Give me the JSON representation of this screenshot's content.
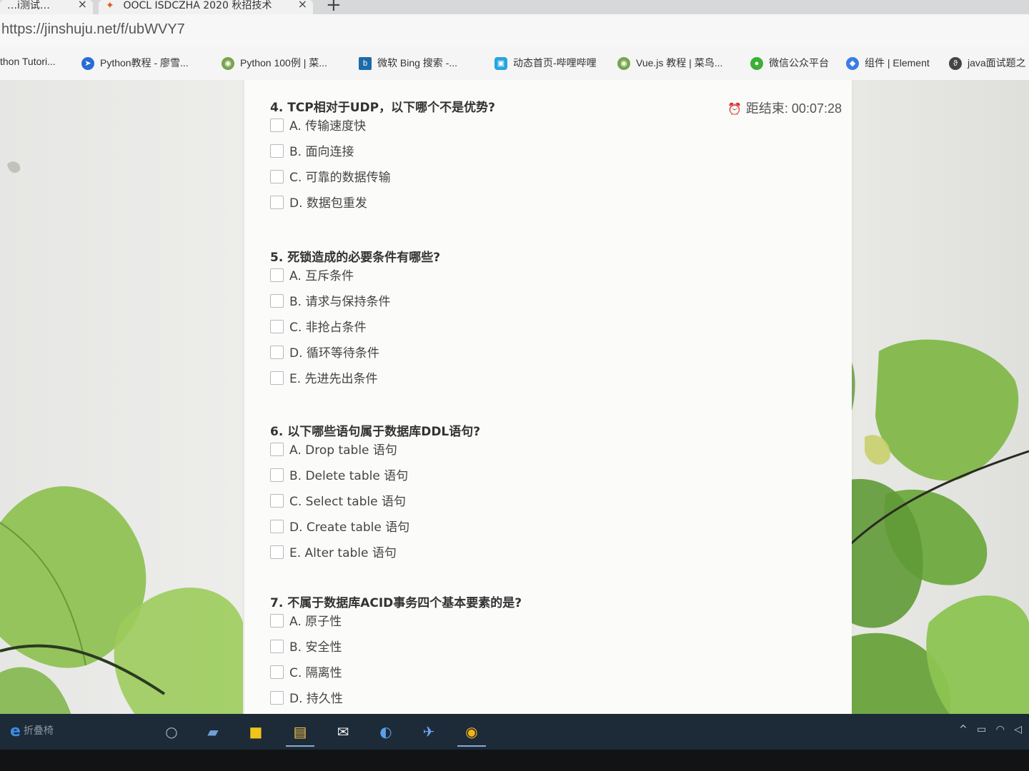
{
  "browser": {
    "tabs": [
      {
        "title": "…i测试…",
        "close": "×"
      },
      {
        "title": "OOCL ISDCZHA 2020 秋招技术",
        "close": "×"
      }
    ],
    "new_tab": "+",
    "url": "https://jinshuju.net/f/ubWVY7",
    "bookmarks": [
      {
        "label": "thon Tutori...",
        "icon": "bookmark-icon"
      },
      {
        "label": "Python教程 - 廖雪...",
        "icon": "rocket-icon"
      },
      {
        "label": "Python 100例 | 菜...",
        "icon": "runoob-icon"
      },
      {
        "label": "微软 Bing 搜索 -...",
        "icon": "bing-icon"
      },
      {
        "label": "动态首页-哔哩哔哩",
        "icon": "bilibili-icon"
      },
      {
        "label": "Vue.js 教程 | 菜鸟...",
        "icon": "runoob-icon"
      },
      {
        "label": "微信公众平台",
        "icon": "wechat-icon"
      },
      {
        "label": "组件 | Element",
        "icon": "element-icon"
      },
      {
        "label": "java面试题之",
        "icon": "java-icon"
      }
    ]
  },
  "form": {
    "timer_label": "距结束: 00:07:28",
    "questions": [
      {
        "title": "4. TCP相对于UDP，以下哪个不是优势?",
        "options": [
          "A. 传输速度快",
          "B. 面向连接",
          "C. 可靠的数据传输",
          "D. 数据包重发"
        ]
      },
      {
        "title": "5. 死锁造成的必要条件有哪些?",
        "options": [
          "A. 互斥条件",
          "B. 请求与保持条件",
          "C. 非抢占条件",
          "D. 循环等待条件",
          "E. 先进先出条件"
        ]
      },
      {
        "title": "6. 以下哪些语句属于数据库DDL语句?",
        "options": [
          "A. Drop table 语句",
          "B. Delete table 语句",
          "C. Select table 语句",
          "D. Create table 语句",
          "E. Alter table 语句"
        ]
      },
      {
        "title": "7. 不属于数据库ACID事务四个基本要素的是?",
        "options": [
          "A. 原子性",
          "B. 安全性",
          "C. 隔离性",
          "D. 持久性"
        ]
      }
    ]
  },
  "taskbar": {
    "search_label": "折叠椅",
    "icons": [
      "search-icon",
      "remote-desktop-icon",
      "sticky-notes-icon",
      "file-explorer-icon",
      "mail-icon",
      "browser-icon",
      "feishu-icon",
      "chrome-icon"
    ]
  }
}
